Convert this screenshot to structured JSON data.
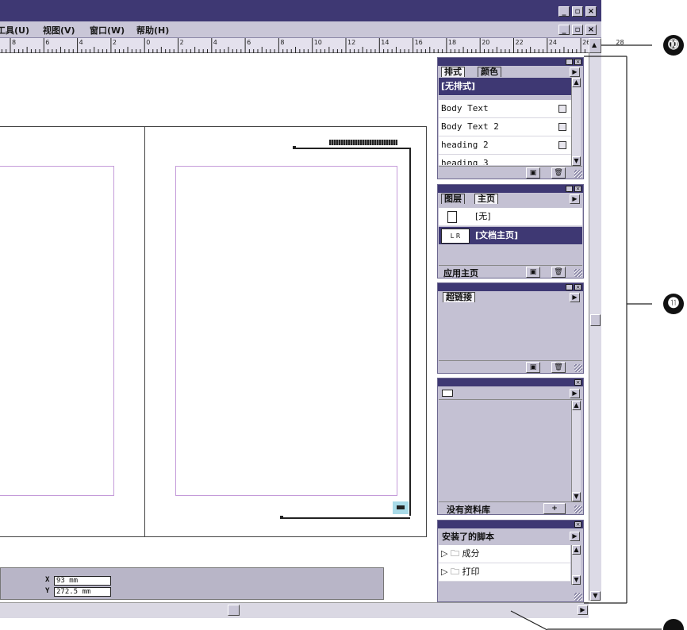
{
  "menubar": {
    "items": [
      "工具(U)",
      "视图(V)",
      "窗口(W)",
      "帮助(H)"
    ]
  },
  "ruler": {
    "labels": [
      "8",
      "6",
      "4",
      "2",
      "0",
      "2",
      "4",
      "6",
      "8",
      "10",
      "12",
      "14",
      "16",
      "18",
      "20",
      "22",
      "24",
      "26",
      "28"
    ]
  },
  "styles_panel": {
    "tabs": [
      "排式",
      "颜色"
    ],
    "selected": "[无排式]",
    "items": [
      "Body Text",
      "Body Text 2",
      "heading 2",
      "heading 3"
    ]
  },
  "pages_panel": {
    "tabs": [
      "图层",
      "主页"
    ],
    "items": [
      "[无]",
      "[文档主页]"
    ],
    "lr_icon": "L R",
    "footer_label": "应用主页"
  },
  "hyperlinks_panel": {
    "tabs": [
      "超链接"
    ]
  },
  "library_panel": {
    "footer_label": "没有资料库",
    "add_label": "+"
  },
  "scripts_panel": {
    "title": "安装了的脚本",
    "items": [
      "成分",
      "打印"
    ]
  },
  "info_bar": {
    "x_label": "X",
    "x_value": "93 mm",
    "y_label": "Y",
    "y_value": "272.5 mm"
  },
  "callouts": [
    "⓾",
    "⓫"
  ],
  "colors": {
    "title_blue": "#3e3873",
    "panel_gray": "#c4c1d3",
    "margin_guide": "#c49bd9"
  }
}
